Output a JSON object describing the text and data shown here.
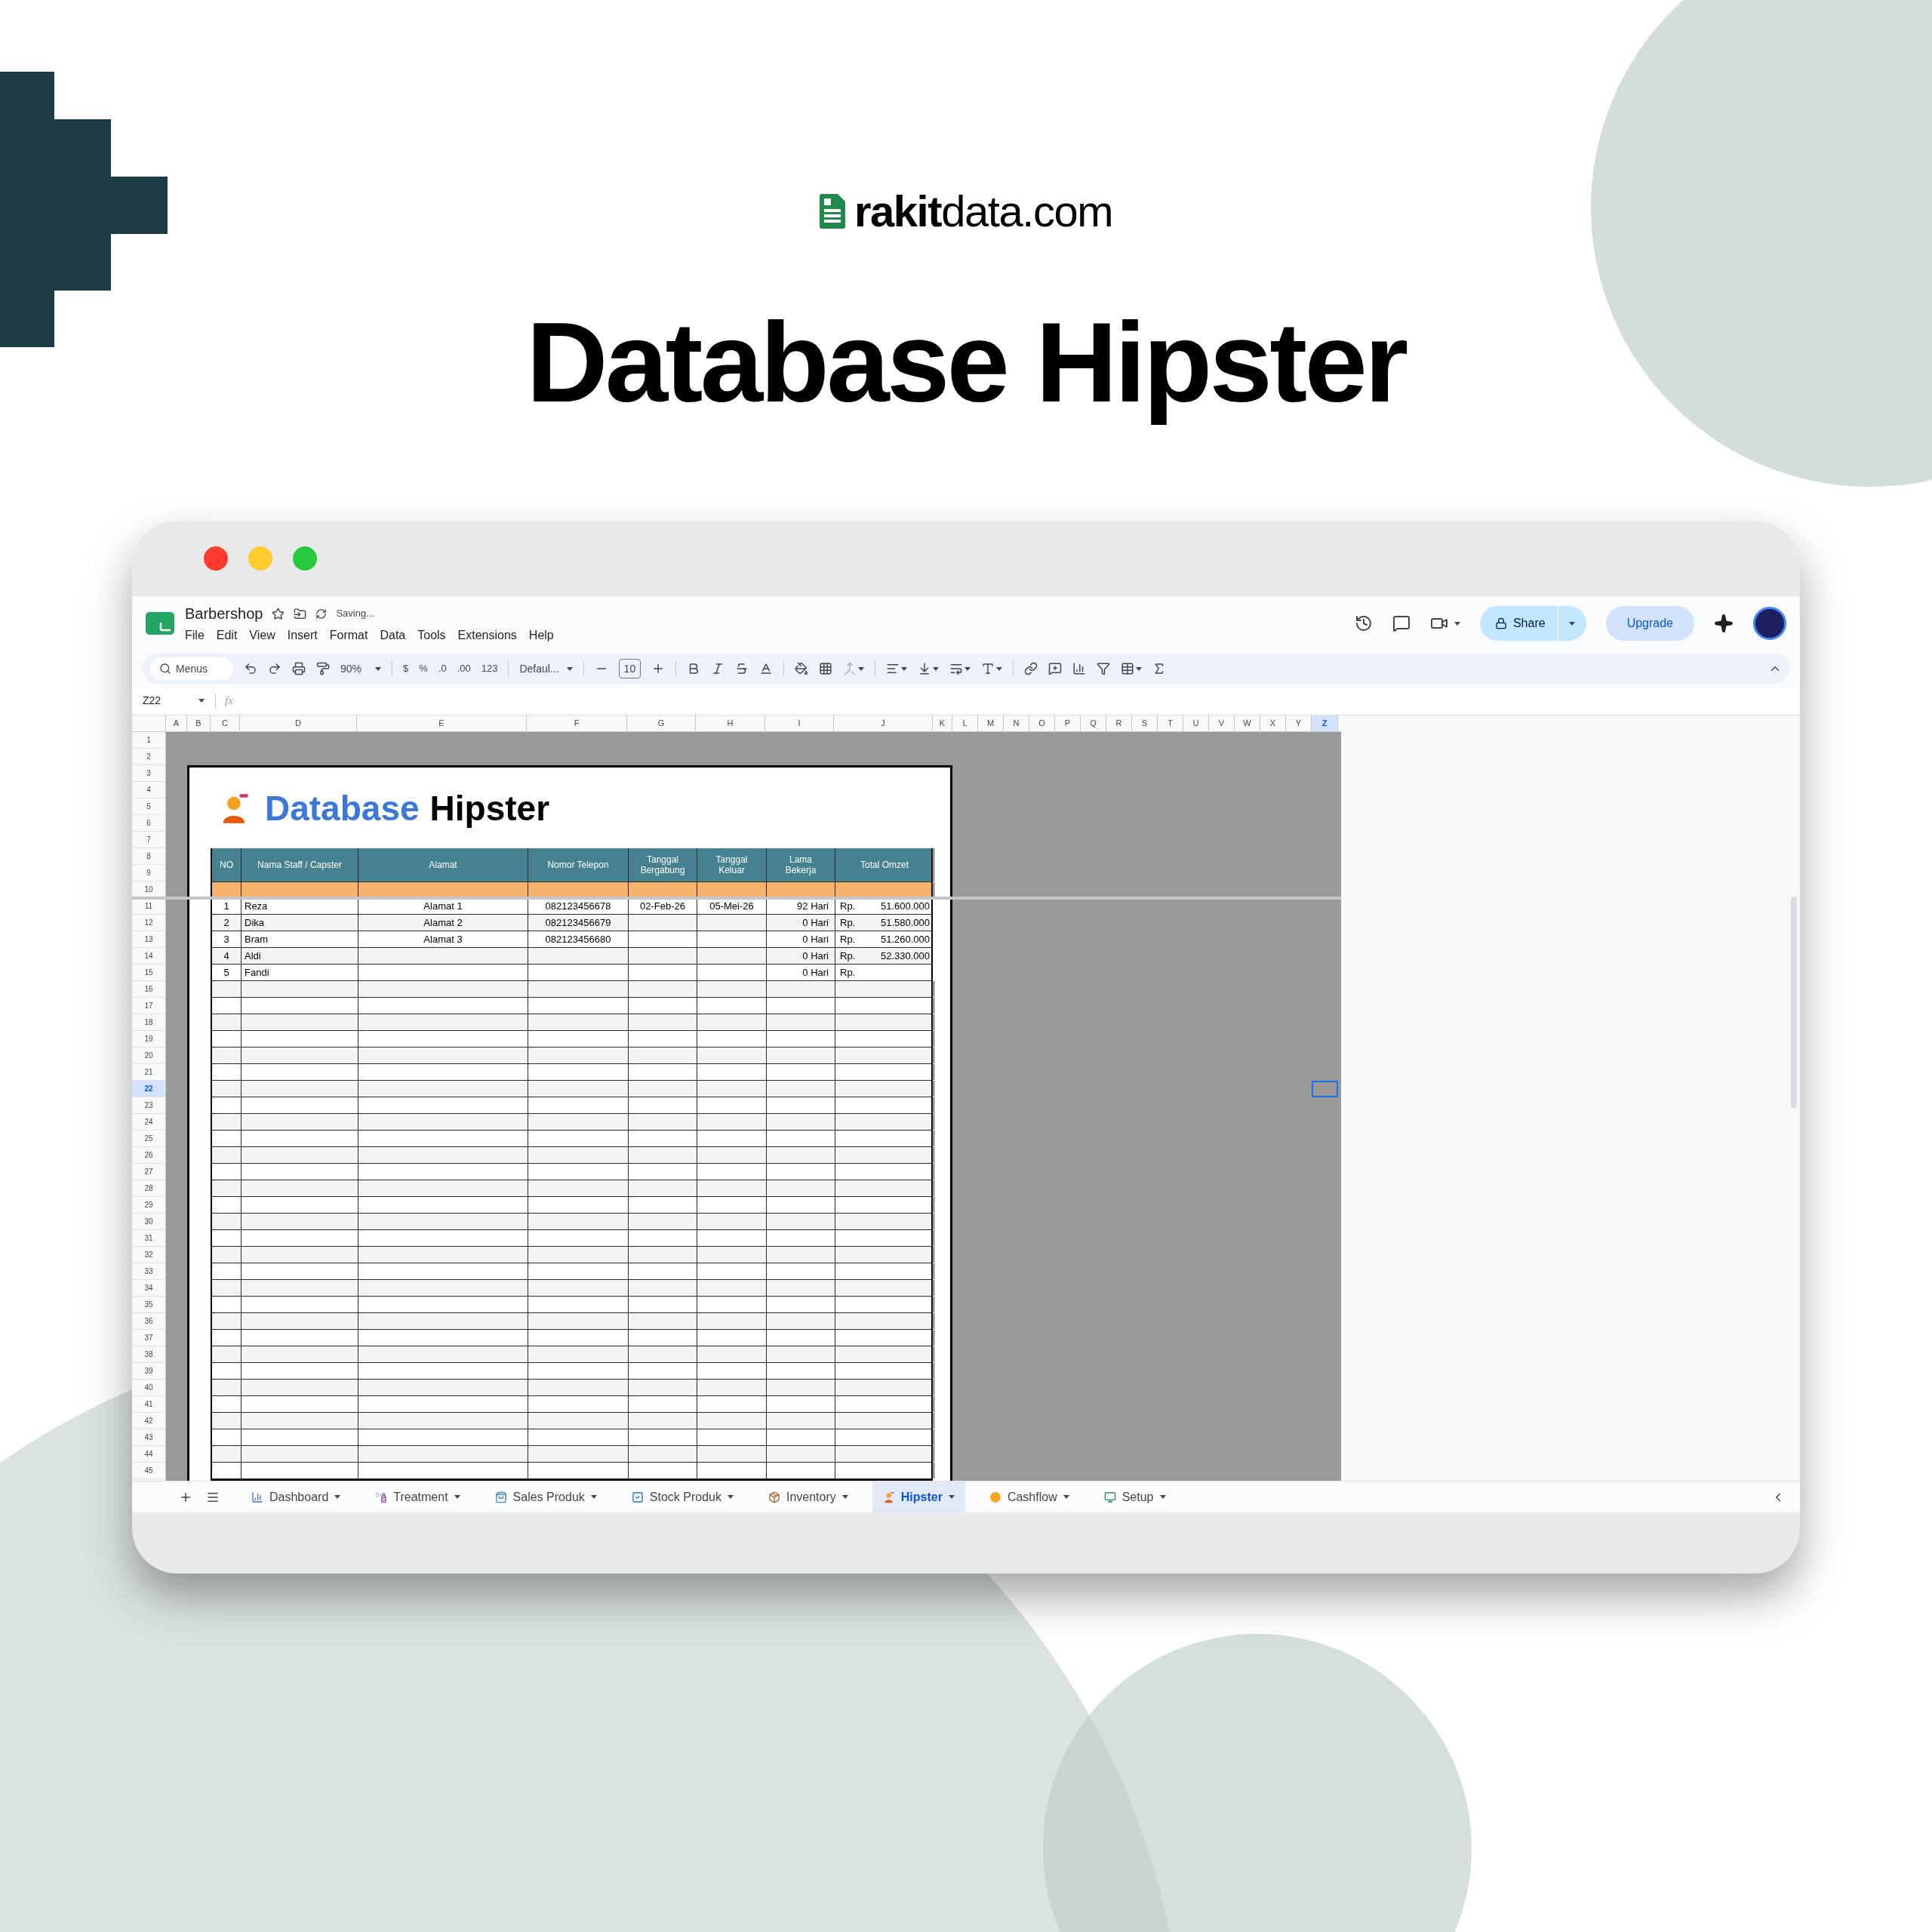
{
  "brand": {
    "logo_text": "**rakit**data.com"
  },
  "headline": "Database Hipster",
  "window": {
    "doc_title": "Barbershop",
    "save_status": "Saving...",
    "menu": [
      "File",
      "Edit",
      "View",
      "Insert",
      "Format",
      "Data",
      "Tools",
      "Extensions",
      "Help"
    ],
    "share_label": "Share",
    "upgrade_label": "Upgrade",
    "toolbar": {
      "search_placeholder": "Menus",
      "zoom": "90%",
      "format_buttons": [
        "$",
        "%",
        ".0",
        ".00",
        "123"
      ],
      "font": "Defaul...",
      "font_size": "10"
    },
    "name_box": "Z22",
    "formula_label": "fx",
    "columns": [
      {
        "label": "A",
        "selected": false
      },
      {
        "label": "B",
        "selected": false
      },
      {
        "label": "C",
        "selected": false
      },
      {
        "label": "D",
        "selected": false
      },
      {
        "label": "E",
        "selected": false
      },
      {
        "label": "F",
        "selected": false
      },
      {
        "label": "G",
        "selected": false
      },
      {
        "label": "H",
        "selected": false
      },
      {
        "label": "I",
        "selected": false
      },
      {
        "label": "J",
        "selected": false
      },
      {
        "label": "K",
        "selected": false
      },
      {
        "label": "L",
        "selected": false
      },
      {
        "label": "M",
        "selected": false
      },
      {
        "label": "N",
        "selected": false
      },
      {
        "label": "O",
        "selected": false
      },
      {
        "label": "P",
        "selected": false
      },
      {
        "label": "Q",
        "selected": false
      },
      {
        "label": "R",
        "selected": false
      },
      {
        "label": "S",
        "selected": false
      },
      {
        "label": "T",
        "selected": false
      },
      {
        "label": "U",
        "selected": false
      },
      {
        "label": "V",
        "selected": false
      },
      {
        "label": "W",
        "selected": false
      },
      {
        "label": "X",
        "selected": false
      },
      {
        "label": "Y",
        "selected": false
      },
      {
        "label": "Z",
        "selected": true
      }
    ],
    "rows": [
      {
        "label": "1",
        "selected": false
      },
      {
        "label": "2",
        "selected": false
      },
      {
        "label": "3",
        "selected": false
      },
      {
        "label": "4",
        "selected": false
      },
      {
        "label": "5",
        "selected": false
      },
      {
        "label": "6",
        "selected": false
      },
      {
        "label": "7",
        "selected": false
      },
      {
        "label": "8",
        "selected": false
      },
      {
        "label": "9",
        "selected": false
      },
      {
        "label": "10",
        "selected": false
      },
      {
        "label": "11",
        "selected": false
      },
      {
        "label": "12",
        "selected": false
      },
      {
        "label": "13",
        "selected": false
      },
      {
        "label": "14",
        "selected": false
      },
      {
        "label": "15",
        "selected": false
      },
      {
        "label": "16",
        "selected": false
      },
      {
        "label": "17",
        "selected": false
      },
      {
        "label": "18",
        "selected": false
      },
      {
        "label": "19",
        "selected": false
      },
      {
        "label": "20",
        "selected": false
      },
      {
        "label": "21",
        "selected": false
      },
      {
        "label": "22",
        "selected": true
      },
      {
        "label": "23",
        "selected": false
      },
      {
        "label": "24",
        "selected": false
      },
      {
        "label": "25",
        "selected": false
      },
      {
        "label": "26",
        "selected": false
      },
      {
        "label": "27",
        "selected": false
      },
      {
        "label": "28",
        "selected": false
      },
      {
        "label": "29",
        "selected": false
      },
      {
        "label": "30",
        "selected": false
      },
      {
        "label": "31",
        "selected": false
      },
      {
        "label": "32",
        "selected": false
      },
      {
        "label": "33",
        "selected": false
      },
      {
        "label": "34",
        "selected": false
      },
      {
        "label": "35",
        "selected": false
      },
      {
        "label": "36",
        "selected": false
      },
      {
        "label": "37",
        "selected": false
      },
      {
        "label": "38",
        "selected": false
      },
      {
        "label": "39",
        "selected": false
      },
      {
        "label": "40",
        "selected": false
      },
      {
        "label": "41",
        "selected": false
      },
      {
        "label": "42",
        "selected": false
      },
      {
        "label": "43",
        "selected": false
      },
      {
        "label": "44",
        "selected": false
      },
      {
        "label": "45",
        "selected": false
      }
    ],
    "sheet": {
      "title_highlight": "Database",
      "title_rest": "Hipster",
      "table": {
        "columns": [
          "NO",
          "Nama Staff / Capster",
          "Alamat",
          "Nomor Telepon",
          "Tanggal Bergabung",
          "Tanggal Keluar",
          "Lama Bekerja",
          "Total Omzet"
        ],
        "rows": [
          {
            "no": "1",
            "name": "Reza",
            "address": "Alamat 1",
            "phone": "082123456678",
            "join_date": "02-Feb-26",
            "exit_date": "05-Mei-26",
            "tenure": "92 Hari",
            "currency": "Rp.",
            "total": "51.600.000"
          },
          {
            "no": "2",
            "name": "Dika",
            "address": "Alamat 2",
            "phone": "082123456679",
            "tenure": "0 Hari",
            "currency": "Rp.",
            "total": "51.580.000"
          },
          {
            "no": "3",
            "name": "Bram",
            "address": "Alamat 3",
            "phone": "082123456680",
            "tenure": "0 Hari",
            "currency": "Rp.",
            "total": "51.260.000"
          },
          {
            "no": "4",
            "name": "Aldi",
            "tenure": "0 Hari",
            "currency": "Rp.",
            "total": "52.330.000"
          },
          {
            "no": "5",
            "name": "Fandi",
            "tenure": "0 Hari",
            "currency": "Rp."
          }
        ]
      }
    },
    "tabs": [
      {
        "label": "Dashboard",
        "selected": false
      },
      {
        "label": "Treatment",
        "selected": false
      },
      {
        "label": "Sales Produk",
        "selected": false
      },
      {
        "label": "Stock Produk",
        "selected": false
      },
      {
        "label": "Inventory",
        "selected": false
      },
      {
        "label": "Hipster",
        "selected": true
      },
      {
        "label": "Cashflow",
        "selected": false
      },
      {
        "label": "Setup",
        "selected": false
      }
    ]
  }
}
